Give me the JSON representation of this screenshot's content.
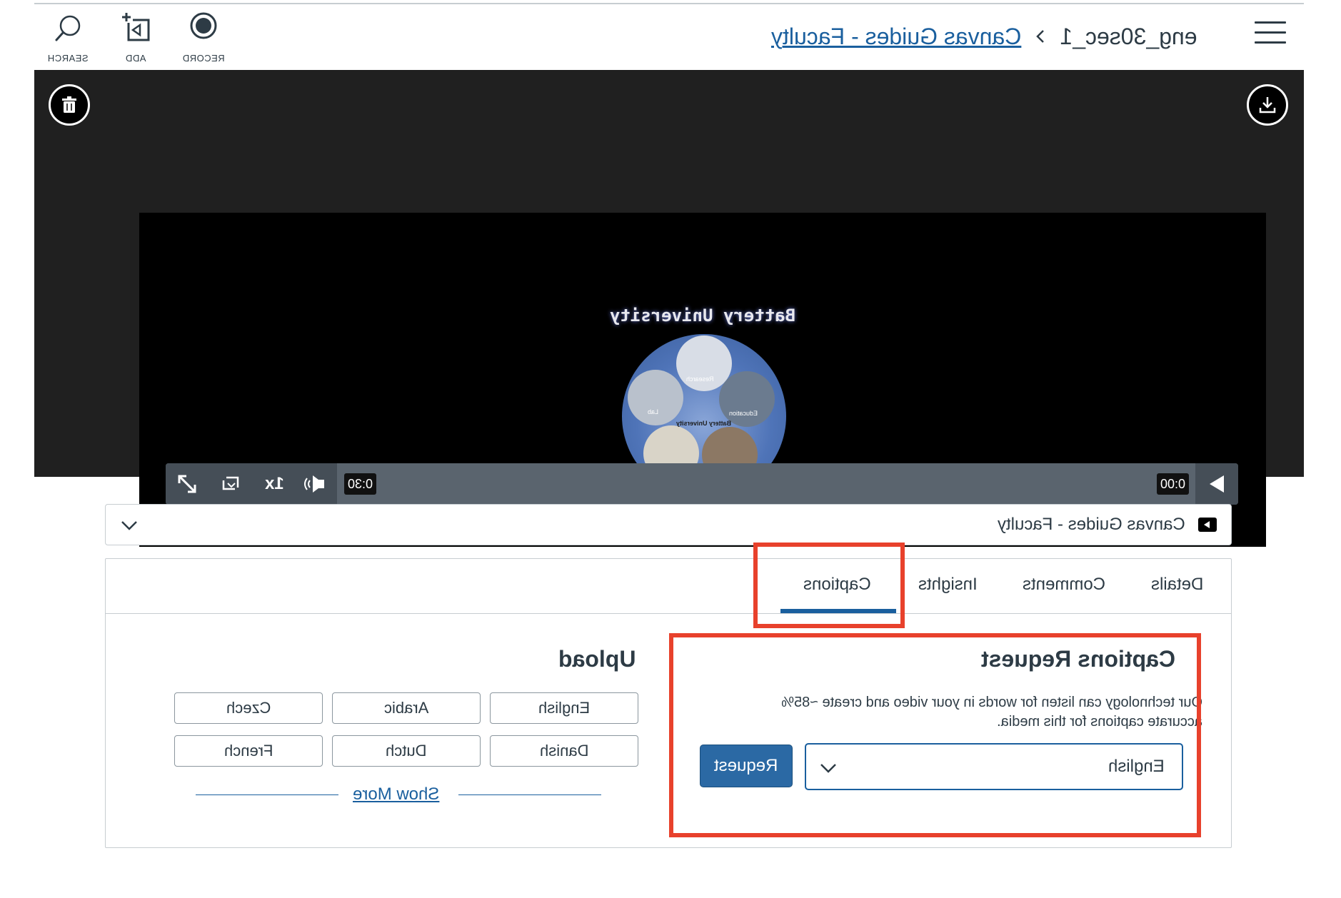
{
  "toolbar": {
    "search_label": "SEARCH",
    "add_label": "ADD",
    "record_label": "RECORD"
  },
  "breadcrumb": {
    "parent": "Canvas Guides - Faculty",
    "current": "eng_30sec_1"
  },
  "video": {
    "title_text": "Battery University",
    "logo_labels": [
      "Research",
      "Education",
      "Lab",
      "Battery University"
    ],
    "current_time": "0:00",
    "duration": "0:30",
    "speed": "1x"
  },
  "source": {
    "selected": "Canvas Guides - Faculty"
  },
  "tabs": [
    {
      "label": "Details"
    },
    {
      "label": "Comments"
    },
    {
      "label": "Insights"
    },
    {
      "label": "Captions"
    }
  ],
  "active_tab": "Captions",
  "upload": {
    "title": "Upload",
    "languages": [
      "English",
      "Arabic",
      "Czech",
      "Danish",
      "Dutch",
      "French"
    ],
    "show_more": "Show More"
  },
  "captions_request": {
    "title": "Captions Request",
    "description_line1": "Our technology can listen for words in your video and create ~85%",
    "description_line2": "accurate captions for this media.",
    "selected_language": "English",
    "request_label": "Request"
  },
  "colors": {
    "link": "#1a5f9e",
    "button": "#2b69a4",
    "highlight": "#e8412c",
    "player_bar": "#5a646e"
  }
}
